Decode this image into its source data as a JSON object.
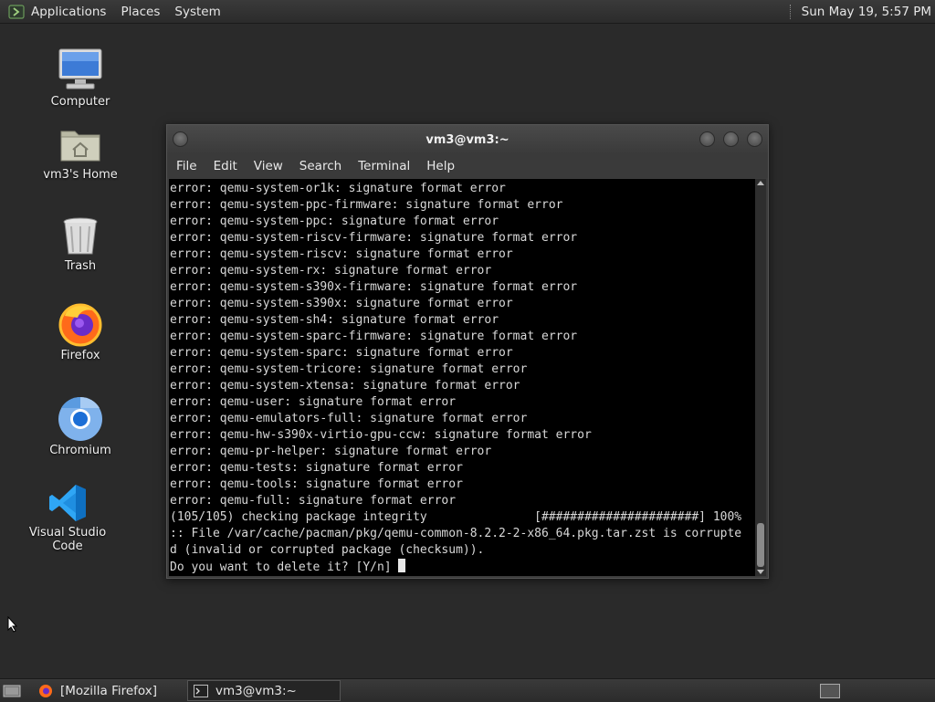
{
  "top_panel": {
    "menus": [
      "Applications",
      "Places",
      "System"
    ],
    "clock": "Sun May 19,  5:57 PM"
  },
  "desktop_icons": [
    {
      "label": "Computer",
      "icon": "computer-icon"
    },
    {
      "label": "vm3's Home",
      "icon": "home-folder-icon"
    },
    {
      "label": "Trash",
      "icon": "trash-icon"
    },
    {
      "label": "Firefox",
      "icon": "firefox-icon"
    },
    {
      "label": "Chromium",
      "icon": "chromium-icon"
    },
    {
      "label": "Visual Studio Code",
      "icon": "vscode-icon"
    }
  ],
  "terminal": {
    "title": "vm3@vm3:~",
    "menu": [
      "File",
      "Edit",
      "View",
      "Search",
      "Terminal",
      "Help"
    ],
    "lines": [
      "error: qemu-system-or1k: signature format error",
      "error: qemu-system-ppc-firmware: signature format error",
      "error: qemu-system-ppc: signature format error",
      "error: qemu-system-riscv-firmware: signature format error",
      "error: qemu-system-riscv: signature format error",
      "error: qemu-system-rx: signature format error",
      "error: qemu-system-s390x-firmware: signature format error",
      "error: qemu-system-s390x: signature format error",
      "error: qemu-system-sh4: signature format error",
      "error: qemu-system-sparc-firmware: signature format error",
      "error: qemu-system-sparc: signature format error",
      "error: qemu-system-tricore: signature format error",
      "error: qemu-system-xtensa: signature format error",
      "error: qemu-user: signature format error",
      "error: qemu-emulators-full: signature format error",
      "error: qemu-hw-s390x-virtio-gpu-ccw: signature format error",
      "error: qemu-pr-helper: signature format error",
      "error: qemu-tests: signature format error",
      "error: qemu-tools: signature format error",
      "error: qemu-full: signature format error",
      "(105/105) checking package integrity               [######################] 100%",
      ":: File /var/cache/pacman/pkg/qemu-common-8.2.2-2-x86_64.pkg.tar.zst is corrupte",
      "d (invalid or corrupted package (checksum))."
    ],
    "prompt": "Do you want to delete it? [Y/n] "
  },
  "taskbar": {
    "tasks": [
      {
        "label": "[Mozilla Firefox]",
        "icon": "firefox-icon",
        "active": false
      },
      {
        "label": "vm3@vm3:~",
        "icon": "terminal-icon",
        "active": true
      }
    ]
  },
  "colors": {
    "desktop_bg": "#2a2a2a",
    "panel_bg": "#333333",
    "terminal_bg": "#000000",
    "terminal_fg": "#d8d8d8"
  }
}
